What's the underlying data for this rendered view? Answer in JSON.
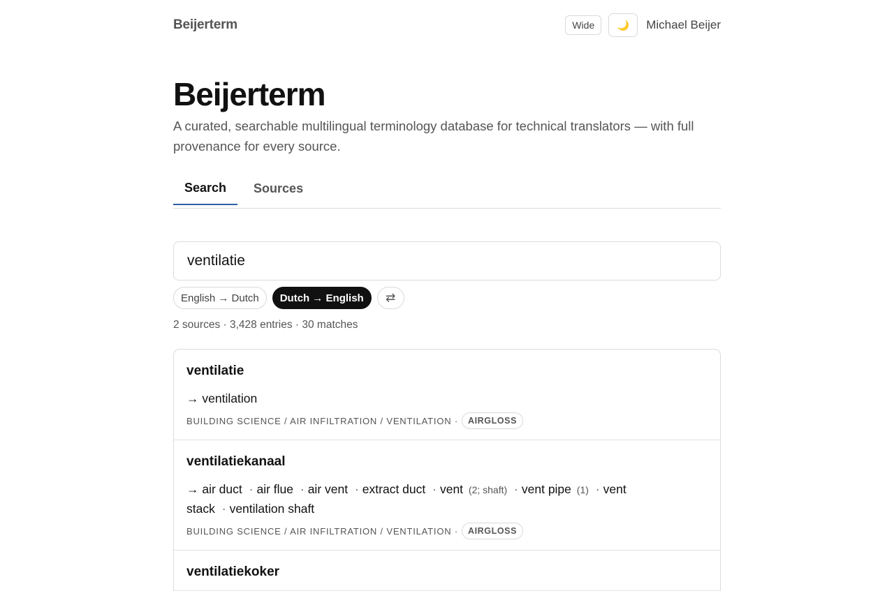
{
  "header": {
    "brand": "Beijerterm",
    "wide_label": "Wide",
    "theme_icon": "moon-icon",
    "theme_glyph": "🌙",
    "user_name": "Michael Beijer"
  },
  "hero": {
    "title": "Beijerterm",
    "subtitle": "A curated, searchable multilingual terminology database for technical translators — with full provenance for every source."
  },
  "tabs": [
    {
      "label": "Search",
      "active": true
    },
    {
      "label": "Sources",
      "active": false
    }
  ],
  "search": {
    "value": "ventilatie"
  },
  "direction": {
    "options": [
      {
        "label": "English → Dutch",
        "active": false
      },
      {
        "label": "Dutch → English",
        "active": true
      }
    ],
    "swap_icon": "swap-arrows-icon",
    "swap_glyph": "⇄"
  },
  "stats": "2 sources · 3,428 entries · 30 matches",
  "results": [
    {
      "term": "ventilatie",
      "translations": [
        {
          "text": "ventilation",
          "note": ""
        }
      ],
      "domain": "BUILDING SCIENCE / AIR INFILTRATION / VENTILATION ·",
      "source": "AIRGLOSS"
    },
    {
      "term": "ventilatiekanaal",
      "translations": [
        {
          "text": "air duct",
          "note": ""
        },
        {
          "text": "air flue",
          "note": ""
        },
        {
          "text": "air vent",
          "note": ""
        },
        {
          "text": "extract duct",
          "note": ""
        },
        {
          "text": "vent",
          "note": "(2; shaft)"
        },
        {
          "text": "vent pipe",
          "note": "(1)"
        },
        {
          "text": "vent stack",
          "note": ""
        },
        {
          "text": "ventilation shaft",
          "note": ""
        }
      ],
      "domain": "BUILDING SCIENCE / AIR INFILTRATION / VENTILATION ·",
      "source": "AIRGLOSS"
    },
    {
      "term": "ventilatiekoker",
      "translations": [],
      "domain": "",
      "source": ""
    }
  ],
  "arrow": "→",
  "dot": "·"
}
